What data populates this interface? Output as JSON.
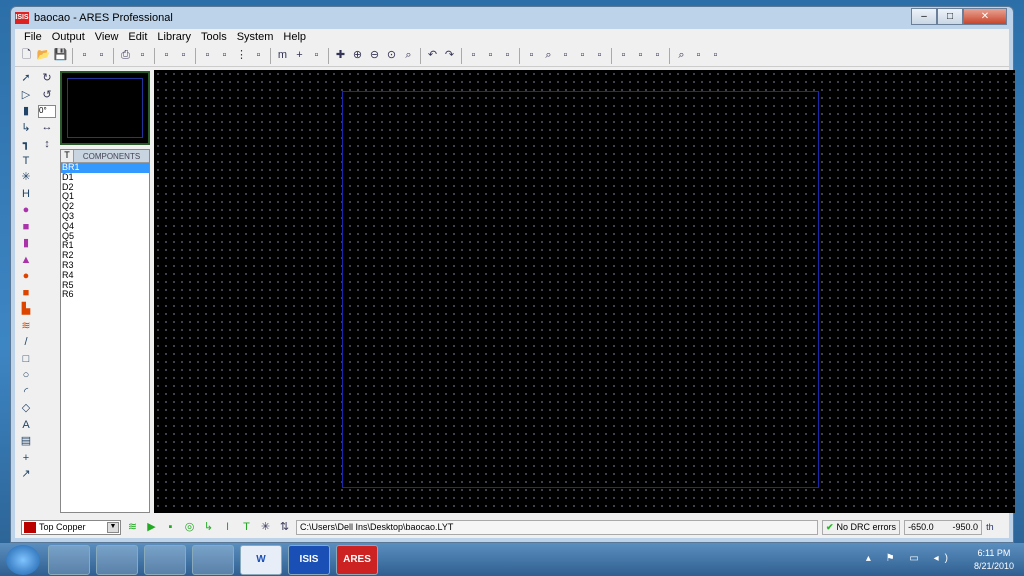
{
  "window": {
    "title": "baocao - ARES Professional",
    "app_icon": "ISIS",
    "controls": [
      "minimize",
      "maximize",
      "close"
    ]
  },
  "menu": [
    "File",
    "Output",
    "View",
    "Edit",
    "Library",
    "Tools",
    "System",
    "Help"
  ],
  "toolbar_icons": [
    "new",
    "open",
    "save",
    "import",
    "export",
    "print",
    "print-preview",
    "netlist",
    "3d-view",
    "refresh",
    "design-rule",
    "grid",
    "layers",
    "metric",
    "origin",
    "coord",
    "pan",
    "zoom-in",
    "zoom-out",
    "zoom-all",
    "zoom-area",
    "undo",
    "redo",
    "cut",
    "copy",
    "paste",
    "tag",
    "find",
    "block-copy",
    "block-move",
    "block-rotate",
    "block-delete",
    "pick",
    "package",
    "search",
    "autoplace",
    "autoroute"
  ],
  "left_tools": [
    "select",
    "component",
    "package",
    "track",
    "via",
    "zone",
    "ratsnest",
    "connectivity",
    "round-pad",
    "square-pad",
    "dil-pad",
    "edge-pad",
    "circle-pad",
    "rect-pad",
    "polygon-pad",
    "padstack",
    "line",
    "box",
    "circle",
    "arc",
    "path",
    "text",
    "symbol",
    "marker",
    "dimension"
  ],
  "rotation": {
    "value": "0°"
  },
  "components": {
    "tab": "T",
    "header": "COMPONENTS",
    "items": [
      "BR1",
      "D1",
      "D2",
      "Q1",
      "Q2",
      "Q3",
      "Q4",
      "Q5",
      "R1",
      "R2",
      "R3",
      "R4",
      "R5",
      "R6"
    ],
    "selected": "BR1"
  },
  "status": {
    "layer": "Top Copper",
    "path": "C:\\Users\\Dell Ins\\Desktop\\baocao.LYT",
    "drc": "No DRC errors",
    "x": "-650.0",
    "y": "-950.0",
    "units": "th"
  },
  "taskbar": {
    "apps": [
      "Explorer",
      "Media Player",
      "Internet Explorer",
      "Editor",
      "W",
      "ISIS",
      "ARES"
    ],
    "time": "6:11 PM",
    "date": "8/21/2010"
  }
}
